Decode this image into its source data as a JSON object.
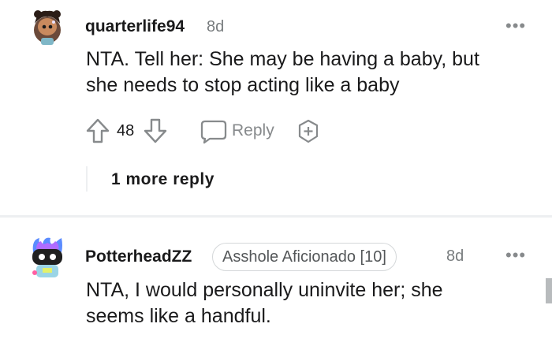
{
  "comments": [
    {
      "username": "quarterlife94",
      "age": "8d",
      "more": "•••",
      "body_line1": "NTA. Tell her: She may be having a baby, but",
      "body_line2": "she needs to stop acting like a baby",
      "votes": "48",
      "reply_label": "Reply",
      "more_replies": "1 more reply"
    },
    {
      "username": "PotterheadZZ",
      "flair": "Asshole Aficionado [10]",
      "age": "8d",
      "more": "•••",
      "body_line1": "NTA, I would personally uninvite her; she",
      "body_line2": "seems like a handful."
    }
  ],
  "icons": {
    "upvote": "arrow-up-icon",
    "downvote": "arrow-down-icon",
    "reply": "speech-bubble-icon",
    "award": "add-award-icon"
  },
  "colors": {
    "text": "#1a1a1b",
    "muted": "#878a8c",
    "divider": "#edeff1"
  }
}
